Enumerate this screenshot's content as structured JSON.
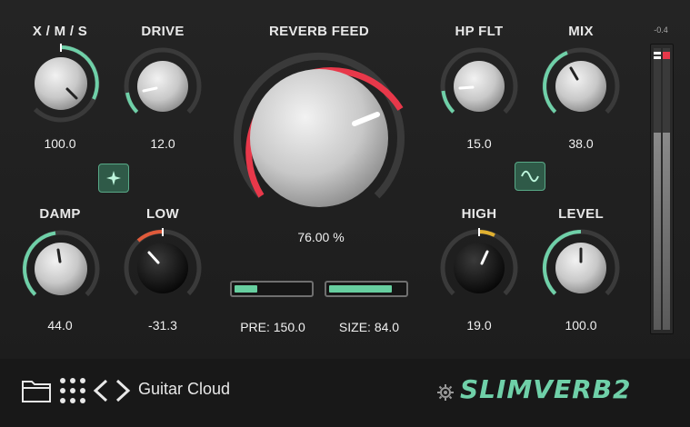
{
  "colors": {
    "accent_green": "#6fd0a8",
    "reverb_red": "#e8384a",
    "low_orange": "#e05a3a",
    "high_yellow": "#e0b030"
  },
  "knobs": {
    "xms": {
      "label": "X / M / S",
      "value": "100.0"
    },
    "drive": {
      "label": "DRIVE",
      "value": "12.0"
    },
    "reverb": {
      "label": "REVERB FEED",
      "value": "76.00 %"
    },
    "hpflt": {
      "label": "HP FLT",
      "value": "15.0"
    },
    "mix": {
      "label": "MIX",
      "value": "38.0"
    },
    "damp": {
      "label": "DAMP",
      "value": "44.0"
    },
    "low": {
      "label": "LOW",
      "value": "-31.3"
    },
    "high": {
      "label": "HIGH",
      "value": "19.0"
    },
    "level": {
      "label": "LEVEL",
      "value": "100.0"
    }
  },
  "buttons": {
    "left_mode_icon": "sparkle-icon",
    "right_mode_icon": "sine-wave-icon"
  },
  "bars": {
    "pre": {
      "text": "PRE: 150.0",
      "fill": 0.3
    },
    "size": {
      "text": "SIZE: 84.0",
      "fill": 0.84
    }
  },
  "meter": {
    "readout": "-0.4",
    "level": 0.7
  },
  "footer": {
    "preset_name": "Guitar Cloud",
    "logo": "SLIMVERB2",
    "icons": [
      "folder-icon",
      "grid-icon",
      "chevron-left-icon",
      "chevron-right-icon",
      "gear-icon"
    ]
  }
}
